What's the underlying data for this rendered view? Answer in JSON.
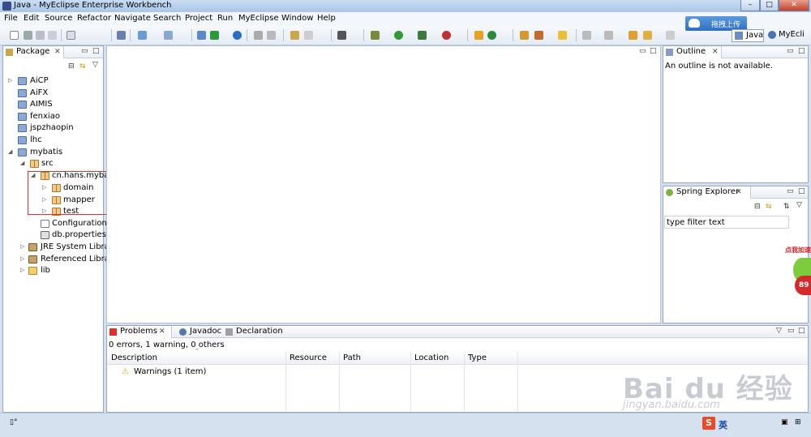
{
  "window": {
    "title": "Java - MyEclipse Enterprise Workbench",
    "controls": {
      "minimize": "–",
      "maximize": "□",
      "close": "✕"
    }
  },
  "menu": [
    "File",
    "Edit",
    "Source",
    "Refactor",
    "Navigate",
    "Search",
    "Project",
    "Run",
    "MyEclipse",
    "Window",
    "Help"
  ],
  "upload_button": "拖拽上传",
  "perspectives": {
    "java": "Java",
    "myeclipse": "MyEcli"
  },
  "package_explorer": {
    "tab": "Package",
    "tree": [
      {
        "label": "AiCP",
        "icon": "project-icon"
      },
      {
        "label": "AiFX",
        "icon": "project-icon"
      },
      {
        "label": "AIMIS",
        "icon": "project-icon"
      },
      {
        "label": "fenxiao",
        "icon": "project-icon"
      },
      {
        "label": "jspzhaopin",
        "icon": "project-icon"
      },
      {
        "label": "lhc",
        "icon": "project-icon"
      },
      {
        "label": "mybatis",
        "icon": "project-icon"
      },
      {
        "label": "src",
        "icon": "source-folder-icon"
      },
      {
        "label": "cn.hans.mybati",
        "icon": "package-icon"
      },
      {
        "label": "domain",
        "icon": "package-icon"
      },
      {
        "label": "mapper",
        "icon": "package-icon"
      },
      {
        "label": "test",
        "icon": "package-icon"
      },
      {
        "label": "Configuration.x",
        "icon": "xml-file-icon"
      },
      {
        "label": "db.properties",
        "icon": "properties-file-icon"
      },
      {
        "label": "JRE System Librar",
        "icon": "library-icon"
      },
      {
        "label": "Referenced Librar",
        "icon": "library-icon"
      },
      {
        "label": "lib",
        "icon": "folder-icon"
      }
    ]
  },
  "outline": {
    "tab": "Outline",
    "message": "An outline is not available."
  },
  "spring_explorer": {
    "tab": "Spring Explorer",
    "filter_placeholder": "type filter text"
  },
  "bottom_panel": {
    "tabs": [
      "Problems",
      "Javadoc",
      "Declaration"
    ],
    "summary": "0 errors, 1 warning, 0 others",
    "columns": [
      "Description",
      "Resource",
      "Path",
      "Location",
      "Type"
    ],
    "rows": [
      {
        "description": "Warnings (1 item)"
      }
    ]
  },
  "ime": {
    "logo": "S",
    "language": "英"
  },
  "overlay": {
    "bubble": "点我加速",
    "badge": "89"
  },
  "watermark": {
    "brand": "Bai du 经验",
    "url": "jingyan.baidu.com"
  }
}
